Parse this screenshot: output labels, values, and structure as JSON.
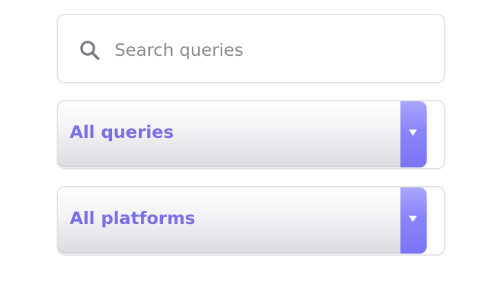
{
  "search": {
    "placeholder": "Search queries",
    "value": "",
    "icon": "search-icon"
  },
  "filters": {
    "queries": {
      "selected": "All queries",
      "icon": "chevron-down-icon"
    },
    "platforms": {
      "selected": "All platforms",
      "icon": "chevron-down-icon"
    }
  },
  "colors": {
    "accent": "#7770e6",
    "button": "#8a84fb",
    "border": "#e3e3e6",
    "placeholder": "#8a8a90"
  }
}
